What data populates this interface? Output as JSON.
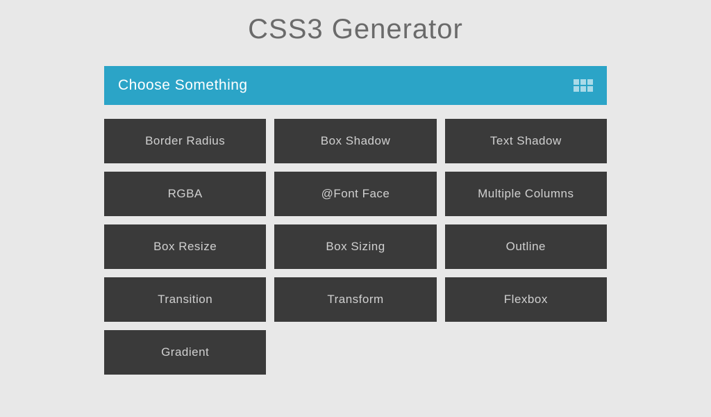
{
  "header": {
    "title": "CSS3 Generator"
  },
  "selector": {
    "label": "Choose Something"
  },
  "options": [
    {
      "label": "Border Radius"
    },
    {
      "label": "Box Shadow"
    },
    {
      "label": "Text Shadow"
    },
    {
      "label": "RGBA"
    },
    {
      "label": "@Font Face"
    },
    {
      "label": "Multiple Columns"
    },
    {
      "label": "Box Resize"
    },
    {
      "label": "Box Sizing"
    },
    {
      "label": "Outline"
    },
    {
      "label": "Transition"
    },
    {
      "label": "Transform"
    },
    {
      "label": "Flexbox"
    },
    {
      "label": "Gradient"
    }
  ],
  "colors": {
    "background": "#e8e8e8",
    "accent": "#2ba4c7",
    "tile": "#3a3a3a",
    "titleText": "#6a6a6a"
  }
}
